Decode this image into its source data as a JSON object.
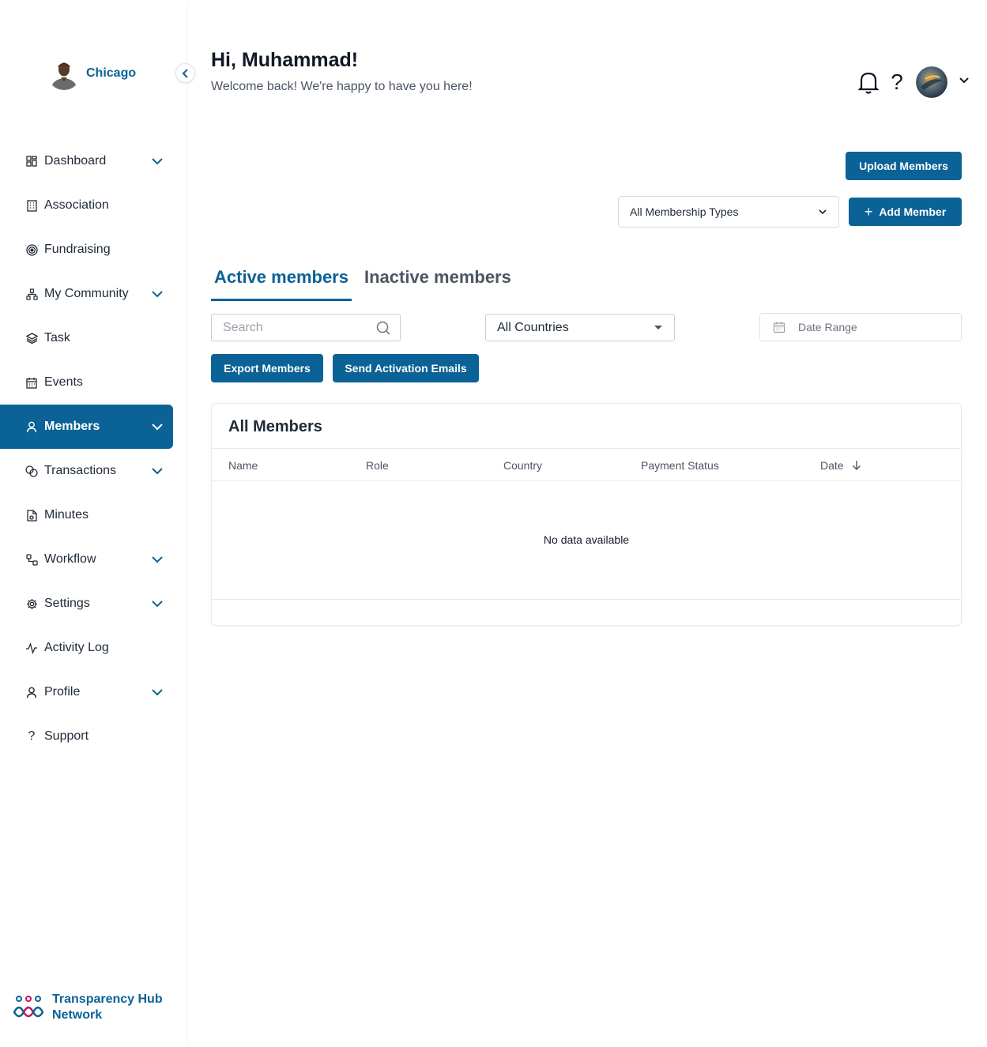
{
  "sidebar": {
    "org_name": "Chicago",
    "items": [
      {
        "label": "Dashboard",
        "icon": "dashboard-icon",
        "expandable": true,
        "active": false
      },
      {
        "label": "Association",
        "icon": "building-icon",
        "expandable": false,
        "active": false
      },
      {
        "label": "Fundraising",
        "icon": "target-icon",
        "expandable": false,
        "active": false
      },
      {
        "label": "My Community",
        "icon": "network-icon",
        "expandable": true,
        "active": false
      },
      {
        "label": "Task",
        "icon": "layers-icon",
        "expandable": false,
        "active": false
      },
      {
        "label": "Events",
        "icon": "calendar-icon",
        "expandable": false,
        "active": false
      },
      {
        "label": "Members",
        "icon": "user-icon",
        "expandable": true,
        "active": true
      },
      {
        "label": "Transactions",
        "icon": "coins-icon",
        "expandable": true,
        "active": false
      },
      {
        "label": "Minutes",
        "icon": "document-icon",
        "expandable": false,
        "active": false
      },
      {
        "label": "Workflow",
        "icon": "workflow-icon",
        "expandable": true,
        "active": false
      },
      {
        "label": "Settings",
        "icon": "gear-icon",
        "expandable": true,
        "active": false
      },
      {
        "label": "Activity Log",
        "icon": "activity-icon",
        "expandable": false,
        "active": false
      },
      {
        "label": "Profile",
        "icon": "person-icon",
        "expandable": true,
        "active": false
      },
      {
        "label": "Support",
        "icon": "question-icon",
        "expandable": false,
        "active": false
      }
    ],
    "brand_line1": "Transparency Hub",
    "brand_line2": "Network"
  },
  "header": {
    "greeting": "Hi, Muhammad!",
    "subtitle": "Welcome back! We're happy to have you here!",
    "help_glyph": "?"
  },
  "actions": {
    "upload_label": "Upload Members",
    "add_label": "Add Member",
    "membership_filter": "All Membership Types"
  },
  "tabs": {
    "active_label": "Active members",
    "inactive_label": "Inactive members"
  },
  "filters": {
    "search_placeholder": "Search",
    "country": "All Countries",
    "date_range_placeholder": "Date Range"
  },
  "buttons": {
    "export_label": "Export Members",
    "activation_label": "Send Activation Emails"
  },
  "table": {
    "title": "All Members",
    "columns": [
      "Name",
      "Role",
      "Country",
      "Payment Status",
      "Date"
    ],
    "empty_message": "No data available"
  },
  "colors": {
    "primary": "#0b6296",
    "text": "#1f2937",
    "muted": "#4b5563",
    "border": "#e7eaee"
  }
}
